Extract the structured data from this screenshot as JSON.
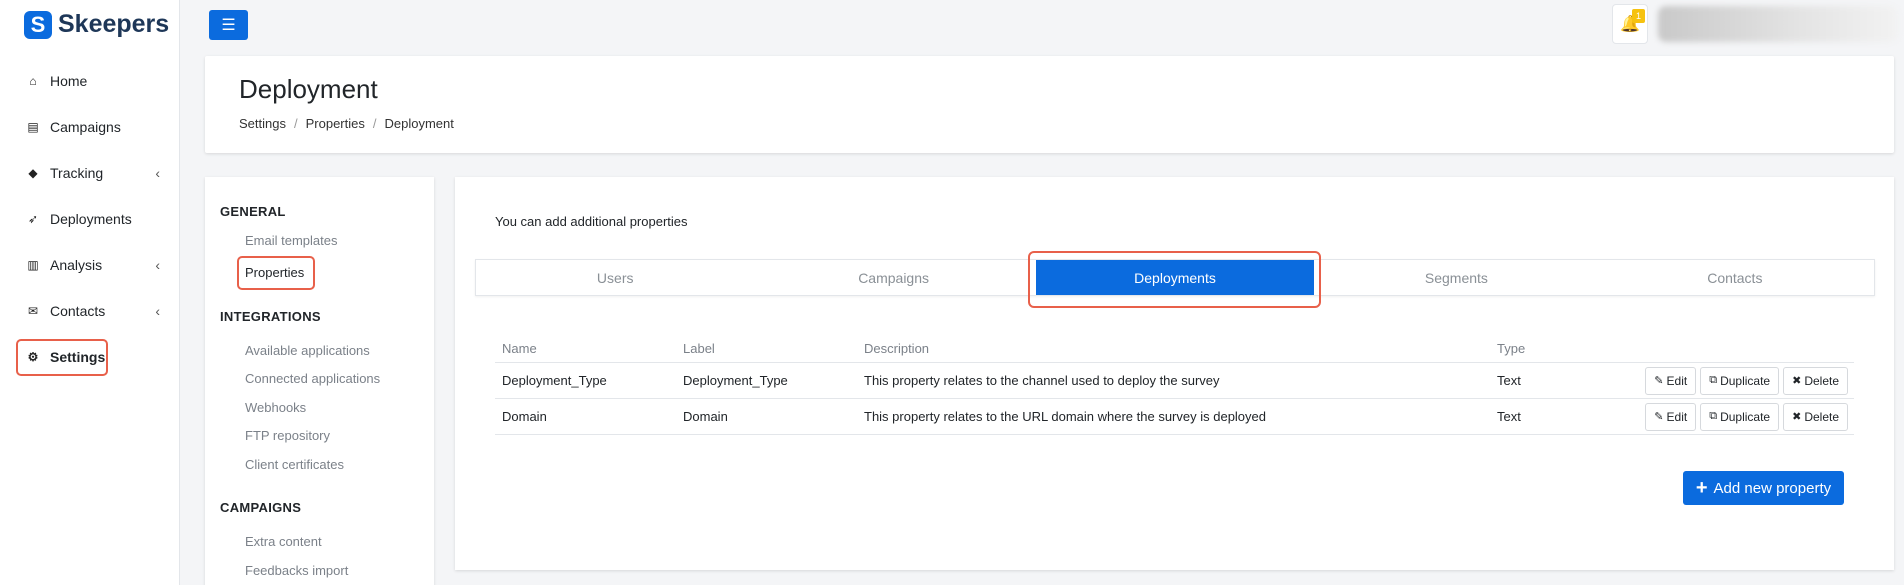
{
  "brand": {
    "name": "Skeepers",
    "logo_glyph": "S"
  },
  "sidebar": {
    "items": [
      {
        "label": "Home",
        "icon": "home-icon",
        "glyph": "⌂",
        "has_chevron": false
      },
      {
        "label": "Campaigns",
        "icon": "file-icon",
        "glyph": "▤",
        "has_chevron": false
      },
      {
        "label": "Tracking",
        "icon": "tag-icon",
        "glyph": "◆",
        "has_chevron": true
      },
      {
        "label": "Deployments",
        "icon": "rocket-icon",
        "glyph": "➶",
        "has_chevron": false
      },
      {
        "label": "Analysis",
        "icon": "bar-chart-icon",
        "glyph": "▥",
        "has_chevron": true
      },
      {
        "label": "Contacts",
        "icon": "envelope-icon",
        "glyph": "✉",
        "has_chevron": true
      },
      {
        "label": "Settings",
        "icon": "gear-icon",
        "glyph": "⚙",
        "has_chevron": false
      }
    ],
    "chevron_glyph": "‹"
  },
  "topbar": {
    "menu_glyph": "☰",
    "bell_glyph": "🔔",
    "notification_count": "1"
  },
  "header": {
    "title": "Deployment",
    "breadcrumb": [
      "Settings",
      "Properties",
      "Deployment"
    ],
    "separator": "/"
  },
  "settings_menu": {
    "general": {
      "title": "GENERAL",
      "items": [
        "Email templates",
        "Properties"
      ]
    },
    "integrations": {
      "title": "INTEGRATIONS",
      "items": [
        "Available applications",
        "Connected applications",
        "Webhooks",
        "FTP repository",
        "Client certificates"
      ]
    },
    "campaigns": {
      "title": "CAMPAIGNS",
      "items": [
        "Extra content",
        "Feedbacks import"
      ]
    }
  },
  "main": {
    "intro": "You can add additional properties",
    "tabs": [
      "Users",
      "Campaigns",
      "Deployments",
      "Segments",
      "Contacts"
    ],
    "active_tab": "Deployments",
    "table": {
      "headers": [
        "Name",
        "Label",
        "Description",
        "Type"
      ],
      "rows": [
        {
          "name": "Deployment_Type",
          "label": "Deployment_Type",
          "description": "This property relates to the channel used to deploy the survey",
          "type": "Text"
        },
        {
          "name": "Domain",
          "label": "Domain",
          "description": "This property relates to the URL domain where the survey is deployed",
          "type": "Text"
        }
      ],
      "actions": {
        "edit": "Edit",
        "duplicate": "Duplicate",
        "delete": "Delete",
        "edit_glyph": "✎",
        "duplicate_glyph": "⧉",
        "delete_glyph": "✖"
      }
    },
    "add_button": {
      "label": "Add new property",
      "glyph": "+"
    }
  },
  "colors": {
    "primary": "#0b6bde",
    "highlight": "#e8604a",
    "badge": "#f6c20f"
  }
}
